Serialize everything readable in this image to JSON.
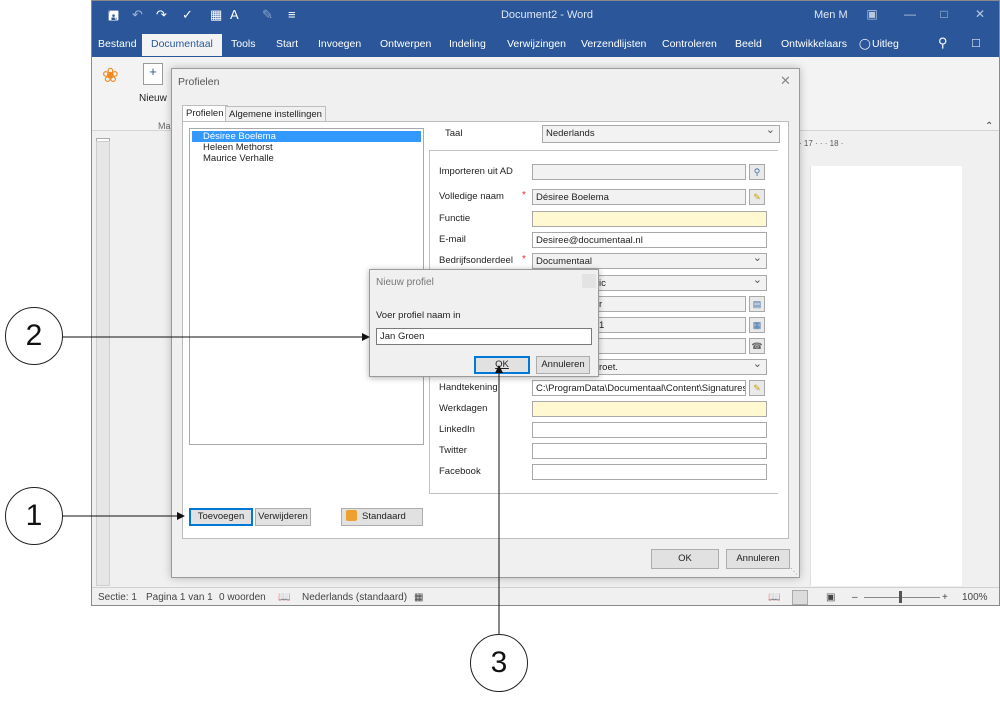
{
  "word": {
    "title": "Document2  -  Word",
    "user": "Men M",
    "tabs": [
      "Bestand",
      "Documentaal",
      "Tools",
      "Start",
      "Invoegen",
      "Ontwerpen",
      "Indeling",
      "Verwijzingen",
      "Verzendlijsten",
      "Controleren",
      "Beeld",
      "Ontwikkelaars",
      "Uitleg"
    ],
    "active_tab": "Documentaal",
    "ribbon_new_label": "Nieuw",
    "ribbon_group_fragment": "Ma",
    "ruler_fragment": "· 17 · · · 18 ·",
    "status": {
      "section": "Sectie: 1",
      "page": "Pagina 1 van 1",
      "words": "0 woorden",
      "language": "Nederlands (standaard)",
      "zoom": "100%"
    }
  },
  "profielen": {
    "title": "Profielen",
    "close_glyph": "✕",
    "tabs": [
      "Profielen",
      "Algemene instellingen"
    ],
    "profiles": [
      "Désiree Boelema",
      "Heleen Methorst",
      "Maurice Verhalle"
    ],
    "selected_profile_index": 0,
    "taal_label": "Taal",
    "taal_value": "Nederlands",
    "fields": {
      "importeren_label": "Importeren uit AD",
      "volledige_naam_label": "Volledige naam",
      "volledige_naam_value": "Désiree Boelema",
      "functie_label": "Functie",
      "email_label": "E-mail",
      "email_value": "Desiree@documentaal.nl",
      "bedrijfsonderdeel_label": "Bedrijfsonderdeel",
      "bedrijfsonderdeel_value": "Documentaal",
      "row5_fragment": "ic",
      "row6_fragment": "r",
      "row7_fragment": "1",
      "row9_fragment": "roet.",
      "handtekening_label": "Handtekening",
      "handtekening_value": "C:\\ProgramData\\Documentaal\\Content\\Signatures\\Har",
      "werkdagen_label": "Werkdagen",
      "linkedin_label": "LinkedIn",
      "twitter_label": "Twitter",
      "facebook_label": "Facebook"
    },
    "buttons": {
      "toevoegen": "Toevoegen",
      "verwijderen": "Verwijderen",
      "standaard": "Standaard",
      "ok": "OK",
      "annuleren": "Annuleren"
    }
  },
  "nieuw_profiel": {
    "title": "Nieuw profiel",
    "prompt": "Voer profiel naam in",
    "input_value": "Jan Groen",
    "ok": "OK",
    "annuleren": "Annuleren"
  },
  "callouts": [
    "1",
    "2",
    "3"
  ]
}
